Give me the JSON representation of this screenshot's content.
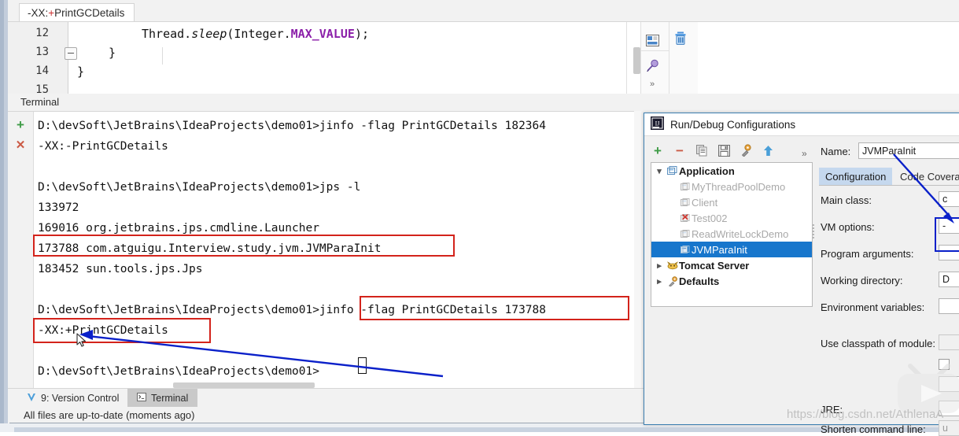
{
  "editor": {
    "tab_label_prefix": "-XX:",
    "tab_label_plus": "+",
    "tab_label_suffix": "PrintGCDetails",
    "line_numbers": [
      "12",
      "13",
      "14",
      "15"
    ],
    "code_lines": [
      "Thread.sleep(Integer.MAX_VALUE);",
      "}",
      "}"
    ],
    "code_tokens": {
      "l12_a": "Thread.",
      "l12_b": "sleep",
      "l12_c": "(Integer.",
      "l12_d": "MAX_VALUE",
      "l12_e": ");",
      "l13": "}",
      "l14": "}"
    },
    "icons": {
      "split_layout": "split-layout-icon",
      "pin": "pin-icon",
      "expand_more": "chevron-double-right-icon",
      "trash": "trash-icon"
    }
  },
  "terminal": {
    "panel_title": "Terminal",
    "side_icons": {
      "new_session": "+",
      "close_session": "✕"
    },
    "lines": [
      "D:\\devSoft\\JetBrains\\IdeaProjects\\demo01>jinfo -flag PrintGCDetails 182364",
      "-XX:-PrintGCDetails",
      "",
      "D:\\devSoft\\JetBrains\\IdeaProjects\\demo01>jps -l",
      "133972",
      "169016 org.jetbrains.jps.cmdline.Launcher",
      "173788 com.atguigu.Interview.study.jvm.JVMParaInit",
      "183452 sun.tools.jps.Jps",
      "",
      "D:\\devSoft\\JetBrains\\IdeaProjects\\demo01>jinfo -flag PrintGCDetails 173788",
      "-XX:+PrintGCDetails",
      "",
      "D:\\devSoft\\JetBrains\\IdeaProjects\\demo01>"
    ],
    "highlight_jps_pid": "173788 com.atguigu.Interview.study.jvm.JVMParaInit",
    "highlight_jinfo_cmd": "jinfo -flag PrintGCDetails 173788",
    "highlight_result": "-XX:+PrintGCDetails"
  },
  "bottom_tabs": [
    {
      "label": "9: Version Control",
      "icon": "version-control-icon",
      "active": false
    },
    {
      "label": "Terminal",
      "icon": "terminal-icon",
      "active": true
    }
  ],
  "status": {
    "message": "All files are up-to-date (moments ago)"
  },
  "dialog": {
    "title": "Run/Debug Configurations",
    "app_icon": "intellij-idea-icon",
    "toolbar": [
      {
        "name": "add-configuration-button",
        "glyph": "+"
      },
      {
        "name": "remove-configuration-button",
        "glyph": "−"
      },
      {
        "name": "copy-configuration-button",
        "glyph": "⧉"
      },
      {
        "name": "save-configuration-button",
        "glyph": "Ὃe"
      },
      {
        "name": "edit-templates-button",
        "glyph": "⚙"
      },
      {
        "name": "move-up-button",
        "glyph": "↑"
      },
      {
        "name": "more-options-button",
        "glyph": "»"
      }
    ],
    "tree": [
      {
        "label": "Application",
        "level": 0,
        "expanded": true,
        "style": "bold",
        "icon": "application-icon"
      },
      {
        "label": "MyThreadPoolDemo",
        "level": 1,
        "style": "dim",
        "icon": "run-config-icon"
      },
      {
        "label": "Client",
        "level": 1,
        "style": "dim",
        "icon": "run-config-icon"
      },
      {
        "label": "Test002",
        "level": 1,
        "style": "dim",
        "icon": "run-config-error-icon"
      },
      {
        "label": "ReadWriteLockDemo",
        "level": 1,
        "style": "dim",
        "icon": "run-config-icon"
      },
      {
        "label": "JVMParaInit",
        "level": 1,
        "style": "selected",
        "icon": "run-config-icon"
      },
      {
        "label": "Tomcat Server",
        "level": 0,
        "expanded": false,
        "style": "bold",
        "icon": "tomcat-icon"
      },
      {
        "label": "Defaults",
        "level": 0,
        "expanded": false,
        "style": "bold",
        "icon": "defaults-icon"
      }
    ],
    "name_label": "Name:",
    "name_value": "JVMParaInit",
    "tabs": [
      {
        "label": "Configuration",
        "active": true
      },
      {
        "label": "Code Coverage",
        "active": false
      }
    ],
    "fields": [
      {
        "label": "Main class:",
        "value": "c",
        "name": "main-class-field",
        "disabled": false
      },
      {
        "label": "VM options:",
        "value": "-",
        "name": "vm-options-field",
        "disabled": false
      },
      {
        "label": "Program arguments:",
        "value": "",
        "name": "program-arguments-field",
        "disabled": false
      },
      {
        "label": "Working directory:",
        "value": "D",
        "name": "working-directory-field",
        "disabled": false
      },
      {
        "label": "Environment variables:",
        "value": "",
        "name": "environment-variables-field",
        "disabled": false
      },
      {
        "label": "Use classpath of module:",
        "value": "",
        "name": "module-classpath-field",
        "disabled": true
      },
      {
        "label": "JRE:",
        "value": "",
        "name": "jre-field",
        "disabled": false
      },
      {
        "label": "Shorten command line:",
        "value": "u",
        "name": "shorten-command-line-field",
        "disabled": true
      }
    ]
  },
  "annotations": {
    "red_boxes": 3,
    "blue_boxes": 1,
    "blue_arrows": 2
  },
  "watermark": {
    "url": "https://blog.csdn.net/AthlenaA",
    "logo": "bilibili-play-logo"
  },
  "colors": {
    "red_highlight": "#d3231b",
    "blue_annotation": "#0a20c9",
    "selection_blue": "#1776cc",
    "tab_active": "#c5d8ee",
    "constant_purple": "#8b1fa9",
    "icon_green": "#3f9c47",
    "icon_red": "#cb5a45"
  }
}
